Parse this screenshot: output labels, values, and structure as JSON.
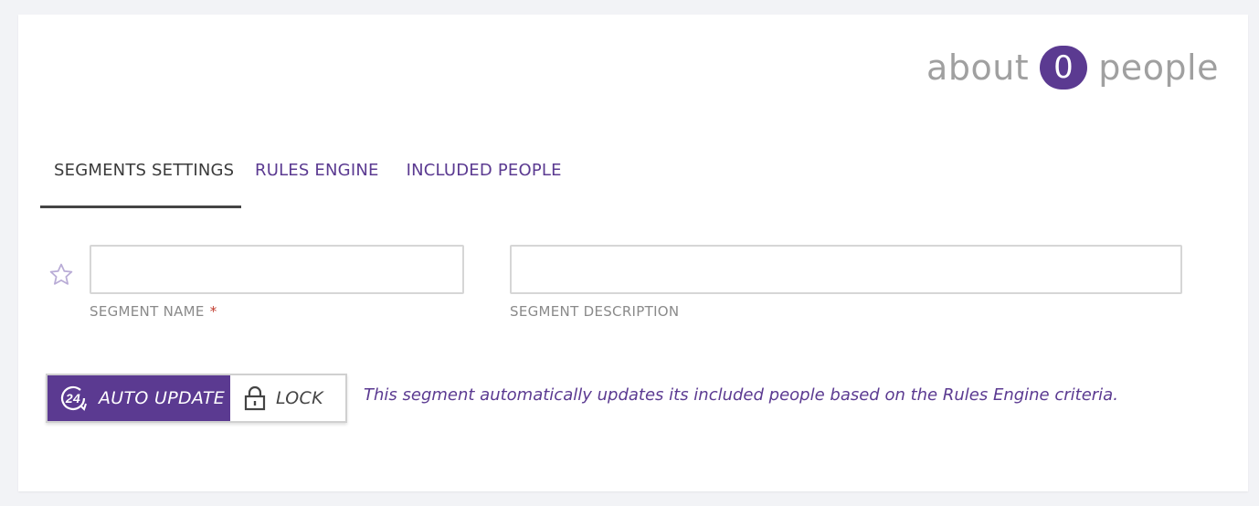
{
  "header": {
    "count_prefix": "about",
    "count_value": "0",
    "count_suffix": "people"
  },
  "tabs": [
    {
      "label": "SEGMENTS SETTINGS",
      "active": true
    },
    {
      "label": "RULES ENGINE",
      "active": false
    },
    {
      "label": "INCLUDED PEOPLE",
      "active": false
    }
  ],
  "form": {
    "favorite_icon": "star-outline-icon",
    "segment_name": {
      "value": "",
      "label": "SEGMENT NAME",
      "required_marker": "*"
    },
    "segment_description": {
      "value": "",
      "label": "SEGMENT DESCRIPTION"
    }
  },
  "update_mode": {
    "auto_update_label": "AUTO UPDATE",
    "auto_update_icon": "24-hour-refresh-icon",
    "auto_update_icon_text": "24",
    "lock_label": "LOCK",
    "lock_icon": "padlock-icon",
    "selected": "auto_update",
    "hint": "This segment automatically updates its included people based on the Rules Engine criteria."
  },
  "colors": {
    "accent": "#5b3a91",
    "muted_text": "#a0a0a0",
    "background": "#f2f3f6"
  }
}
